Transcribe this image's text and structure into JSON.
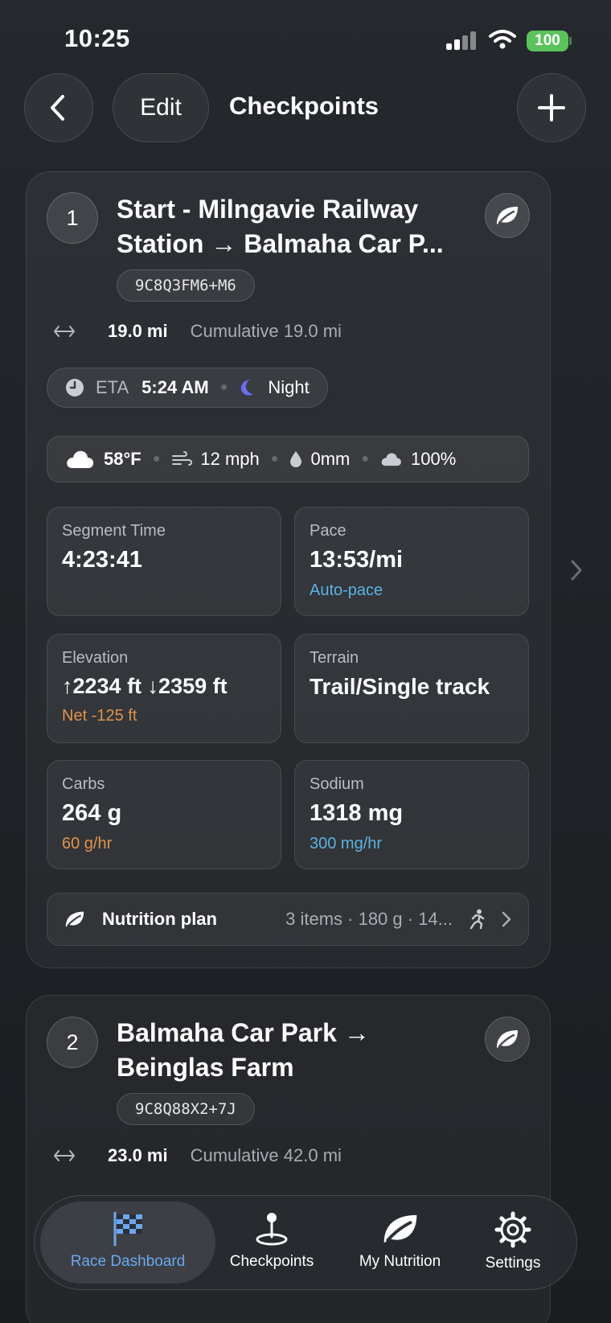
{
  "status_bar": {
    "time": "10:25",
    "battery": "100"
  },
  "header": {
    "edit_label": "Edit",
    "title": "Checkpoints"
  },
  "checkpoints": [
    {
      "number": "1",
      "title": "Start - Milngavie Railway Station → Balmaha Car P...",
      "code": "9C8Q3FM6+M6",
      "distance": "19.0 mi",
      "cumulative": "Cumulative 19.0 mi",
      "eta_label": "ETA",
      "eta_time": "5:24 AM",
      "daylight": "Night",
      "weather": {
        "temp": "58°F",
        "wind": "12 mph",
        "precip": "0mm",
        "cloud": "100%"
      },
      "segment_time_label": "Segment Time",
      "segment_time": "4:23:41",
      "pace_label": "Pace",
      "pace": "13:53/mi",
      "pace_sub": "Auto-pace",
      "elevation_label": "Elevation",
      "elevation": "↑2234 ft  ↓2359 ft",
      "elevation_net": "Net -125 ft",
      "terrain_label": "Terrain",
      "terrain": "Trail/Single track",
      "carbs_label": "Carbs",
      "carbs": "264 g",
      "carbs_rate": "60 g/hr",
      "sodium_label": "Sodium",
      "sodium": "1318 mg",
      "sodium_rate": "300 mg/hr",
      "nutrition_label": "Nutrition plan",
      "nutrition_summary": "3 items · 180 g · 14..."
    },
    {
      "number": "2",
      "title": "Balmaha Car Park → Beinglas Farm",
      "code": "9C8Q88X2+7J",
      "distance": "23.0 mi",
      "cumulative": "Cumulative 42.0 mi"
    }
  ],
  "tabbar": {
    "items": [
      {
        "label": "Race Dashboard",
        "icon": "checkered-flag-icon",
        "active": true
      },
      {
        "label": "Checkpoints",
        "icon": "map-pin-icon",
        "active": false
      },
      {
        "label": "My Nutrition",
        "icon": "leaf-icon",
        "active": false
      },
      {
        "label": "Settings",
        "icon": "gear-icon",
        "active": false
      }
    ]
  },
  "colors": {
    "accent_blue": "#5ab3e0",
    "accent_orange": "#e0924a",
    "battery_green": "#5ac35b",
    "tab_active": "#6aa8f0",
    "moon": "#6c6cf0"
  }
}
